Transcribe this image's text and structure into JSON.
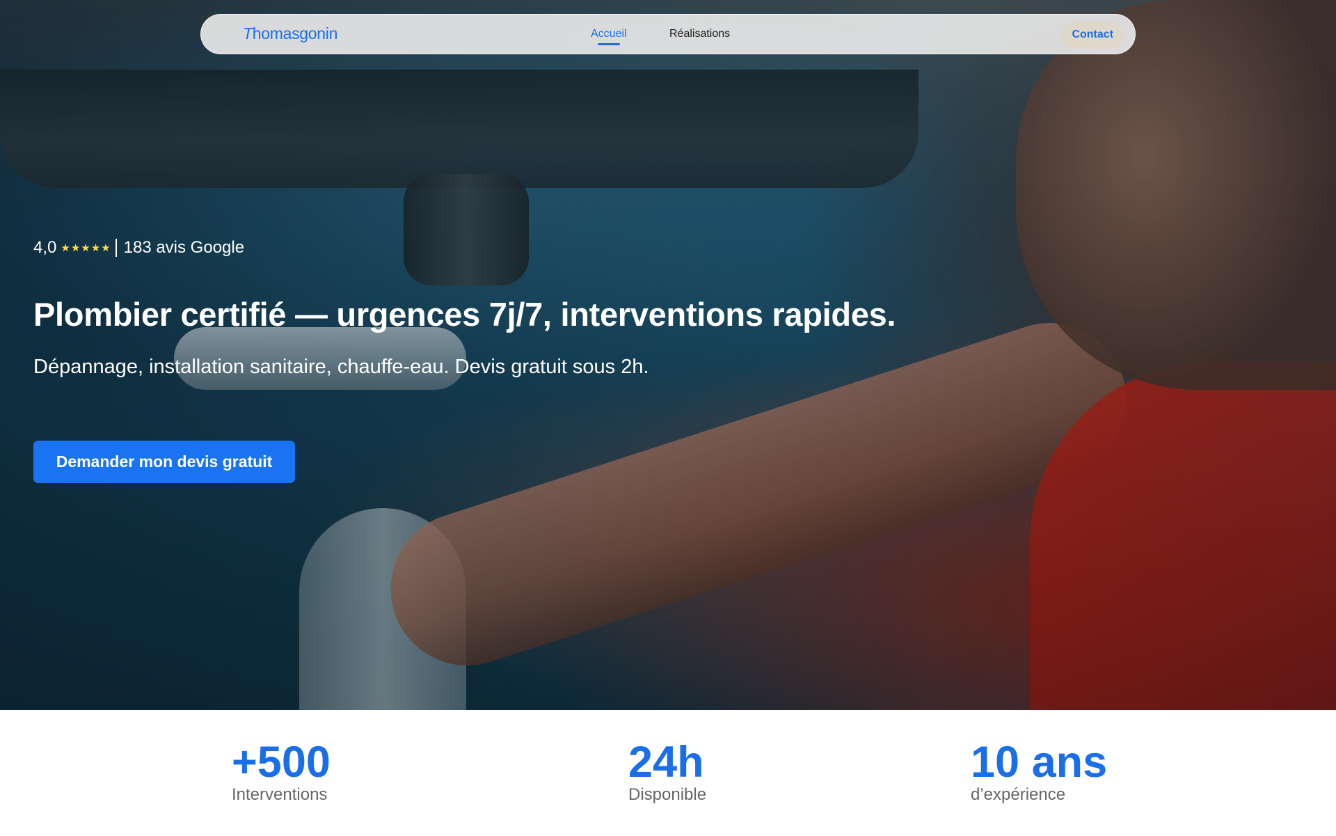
{
  "nav": {
    "logo_first": "T",
    "logo_rest": "homasgonin",
    "links": [
      {
        "label": "Accueil",
        "active": true
      },
      {
        "label": "Réalisations",
        "active": false
      }
    ],
    "contact_label": "Contact"
  },
  "hero": {
    "rating_value": "4,0",
    "stars": "★★★★★",
    "rating_text": "183 avis Google",
    "title": "Plombier certifié — urgences 7j/7, interventions rapides.",
    "subtitle": "Dépannage, installation sanitaire, chauffe-eau. Devis gratuit sous 2h.",
    "cta_label": "Demander mon devis gratuit"
  },
  "stats": [
    {
      "value": "+500",
      "label": "Interventions"
    },
    {
      "value": "24h",
      "label": "Disponible"
    },
    {
      "value": "10 ans",
      "label": "d’expérience"
    }
  ],
  "colors": {
    "accent": "#1a6fe8",
    "star": "#ffd84a"
  }
}
